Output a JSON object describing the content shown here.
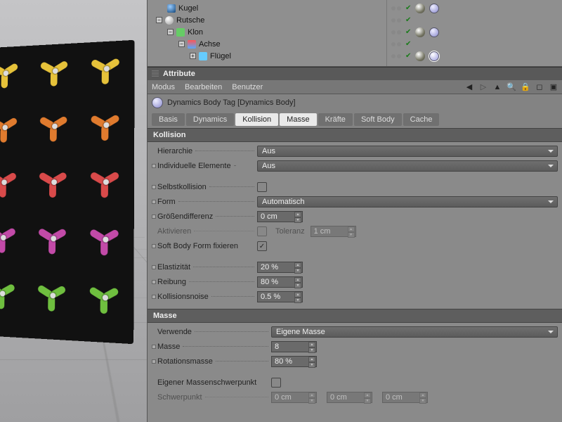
{
  "tree": {
    "items": [
      "Kugel",
      "Rutsche",
      "Klon",
      "Achse",
      "Flügel"
    ]
  },
  "panel": {
    "title": "Attribute",
    "menus": [
      "Modus",
      "Bearbeiten",
      "Benutzer"
    ],
    "tag_line": "Dynamics Body Tag [Dynamics Body]"
  },
  "tabs": [
    "Basis",
    "Dynamics",
    "Kollision",
    "Masse",
    "Kräfte",
    "Soft Body",
    "Cache"
  ],
  "active_tabs": [
    "Kollision",
    "Masse"
  ],
  "kollision": {
    "header": "Kollision",
    "hierarchie_label": "Hierarchie",
    "hierarchie_value": "Aus",
    "indiv_label": "Individuelle Elemente",
    "indiv_value": "Aus",
    "selbst_label": "Selbstkollision",
    "form_label": "Form",
    "form_value": "Automatisch",
    "groesse_label": "Größendifferenz",
    "groesse_value": "0 cm",
    "aktivieren_label": "Aktivieren",
    "toleranz_label": "Toleranz",
    "toleranz_value": "1 cm",
    "softbodyfix_label": "Soft Body Form fixieren",
    "elast_label": "Elastizität",
    "elast_value": "20 %",
    "reibung_label": "Reibung",
    "reibung_value": "80 %",
    "noise_label": "Kollisionsnoise",
    "noise_value": "0.5 %"
  },
  "masse": {
    "header": "Masse",
    "verwende_label": "Verwende",
    "verwende_value": "Eigene Masse",
    "masse_label": "Masse",
    "masse_value": "8",
    "rot_label": "Rotationsmasse",
    "rot_value": "80 %",
    "eigener_label": "Eigener Massenschwerpunkt",
    "schwer_label": "Schwerpunkt",
    "schwer_x": "0 cm",
    "schwer_y": "0 cm",
    "schwer_z": "0 cm"
  },
  "chart_data": null
}
